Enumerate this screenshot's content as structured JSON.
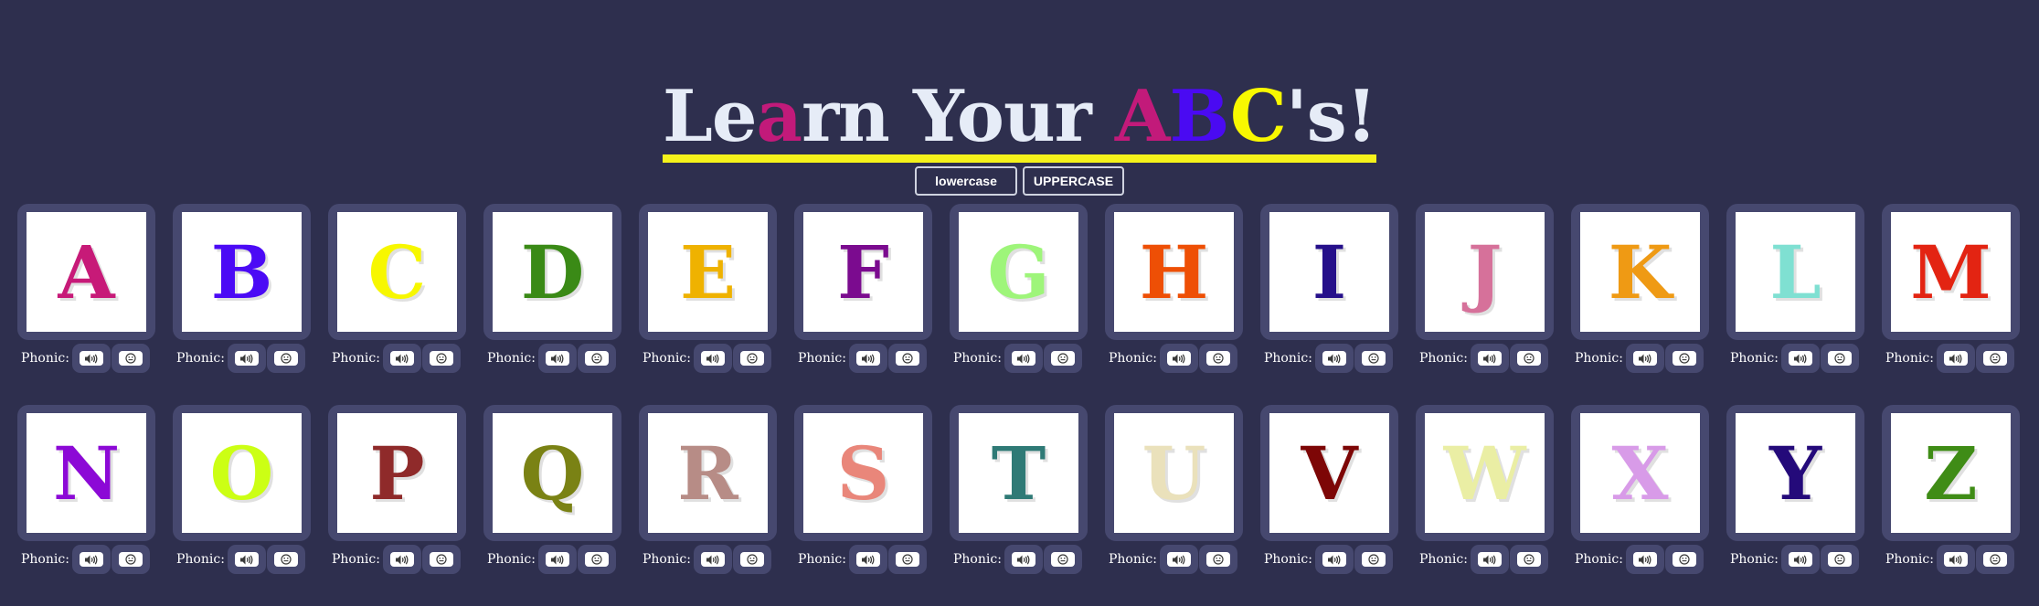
{
  "title": {
    "parts": [
      {
        "text": "Le",
        "color": "#e6ecf7"
      },
      {
        "text": "a",
        "color": "#c21a7a"
      },
      {
        "text": "rn Your ",
        "color": "#e6ecf7"
      },
      {
        "text": "A",
        "color": "#c21a7a"
      },
      {
        "text": "B",
        "color": "#4a0af2"
      },
      {
        "text": "C",
        "color": "#f8f800"
      },
      {
        "text": "'s!",
        "color": "#e6ecf7"
      }
    ],
    "underline_color": "#f5f21b"
  },
  "case_toggle": {
    "lower_label": "lowercase",
    "upper_label": "UPPERCASE"
  },
  "phonic_label": "Phonic:",
  "icons": {
    "sound": "speaker-icon",
    "face": "smiley-icon"
  },
  "letters": [
    {
      "letter": "A",
      "color": "#c71a78"
    },
    {
      "letter": "B",
      "color": "#4b0af5"
    },
    {
      "letter": "C",
      "color": "#f7f700"
    },
    {
      "letter": "D",
      "color": "#3a8a16"
    },
    {
      "letter": "E",
      "color": "#efb200"
    },
    {
      "letter": "F",
      "color": "#7b0b8f"
    },
    {
      "letter": "G",
      "color": "#9ef57a"
    },
    {
      "letter": "H",
      "color": "#ee4f05"
    },
    {
      "letter": "I",
      "color": "#26108a"
    },
    {
      "letter": "J",
      "color": "#d6719a"
    },
    {
      "letter": "K",
      "color": "#ef9a14"
    },
    {
      "letter": "L",
      "color": "#7fe0d2"
    },
    {
      "letter": "M",
      "color": "#e32412"
    },
    {
      "letter": "N",
      "color": "#8c09d6"
    },
    {
      "letter": "O",
      "color": "#ccff14"
    },
    {
      "letter": "P",
      "color": "#8f2a2a"
    },
    {
      "letter": "Q",
      "color": "#7a8214"
    },
    {
      "letter": "R",
      "color": "#b78c86"
    },
    {
      "letter": "S",
      "color": "#e9867a"
    },
    {
      "letter": "T",
      "color": "#2f7a76"
    },
    {
      "letter": "U",
      "color": "#eae1bb"
    },
    {
      "letter": "V",
      "color": "#7d0606"
    },
    {
      "letter": "W",
      "color": "#eaeea4"
    },
    {
      "letter": "X",
      "color": "#d89be8"
    },
    {
      "letter": "Y",
      "color": "#240a7a"
    },
    {
      "letter": "Z",
      "color": "#3f8c16"
    }
  ]
}
